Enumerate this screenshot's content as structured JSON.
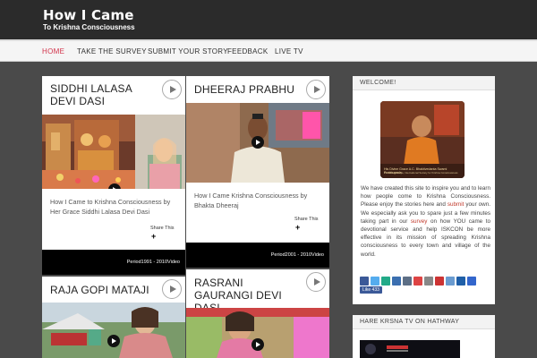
{
  "site": {
    "logo_main": "How I Came",
    "logo_sub": "To Krishna Consciousness"
  },
  "nav": {
    "items": [
      {
        "label": "HOME",
        "active": true
      },
      {
        "label": "TAKE THE SURVEY",
        "active": false
      },
      {
        "label": "SUBMIT YOUR STORY",
        "active": false
      },
      {
        "label": "FEEDBACK",
        "active": false
      },
      {
        "label": "LIVE TV",
        "active": false
      }
    ]
  },
  "cards": [
    {
      "title": "SIDDHI LALASA DEVI DASI",
      "excerpt": "How I Came to Krishna Consciousness by Her Grace Siddhi Lalasa Devi Dasi",
      "share_label": "Share This",
      "period": "Period1991 - 2010Video"
    },
    {
      "title": "DHEERAJ PRABHU",
      "excerpt": "How I Came Krishna Consciousness by Bhakta Dheeraj",
      "share_label": "Share This",
      "period": "Period2001 - 2010Video"
    },
    {
      "title": "RAJA GOPI MATAJI"
    },
    {
      "title": "RASRANI GAURANGI DEVI DASI"
    }
  ],
  "sidebar": {
    "welcome": {
      "heading": "WELCOME!",
      "caption": "His Divine Grace A.C. Bhaktivedanta Swami Prabhupada",
      "caption_sub": "Founder-Acharya, International Society for Krishna Consciousness",
      "text_1": "We have created this site to inspire you and to learn how people come to Krishna Consciousness. Please enjoy the stories here and ",
      "link_submit": "submit",
      "text_2": " your own. We especially ask you to spare just a few minutes taking part in our ",
      "link_survey": "survey",
      "text_3": " on how YOU came to devotional service and help ISKCON be more effective in its mission of spreading Krishna consciousness to every town and village of the world.",
      "like_label": "Like 433"
    },
    "tv": {
      "heading": "HARE KRSNA TV ON HATHWAY"
    }
  },
  "colors": {
    "accent": "#d2334b",
    "header_bg": "#2b2b2b",
    "page_bg": "#4a4a4a"
  }
}
